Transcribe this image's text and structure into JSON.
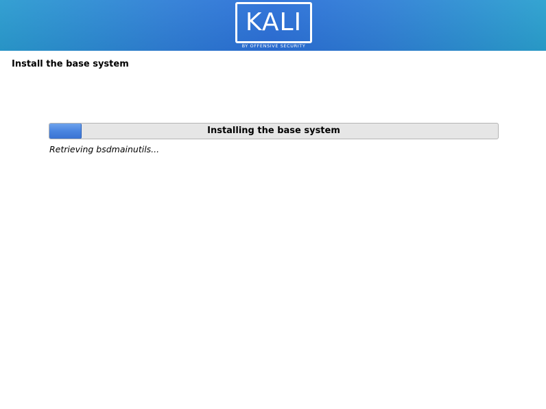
{
  "header": {
    "logo_text": "KALI",
    "logo_subtitle": "BY OFFENSIVE SECURITY"
  },
  "page": {
    "title": "Install the base system"
  },
  "progress": {
    "label": "Installing the base system",
    "value_percent": 7,
    "status": "Retrieving bsdmainutils..."
  }
}
